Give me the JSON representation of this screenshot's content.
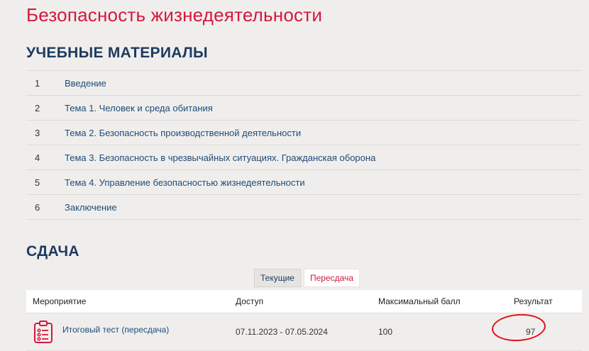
{
  "page": {
    "title": "Безопасность жизнедеятельности"
  },
  "materials": {
    "title": "УЧЕБНЫЕ МАТЕРИАЛЫ",
    "items": [
      {
        "num": "1",
        "label": "Введение"
      },
      {
        "num": "2",
        "label": "Тема 1. Человек и среда обитания"
      },
      {
        "num": "3",
        "label": "Тема 2. Безопасность производственной деятельности"
      },
      {
        "num": "4",
        "label": "Тема 3. Безопасность в чрезвычайных ситуациях. Гражданская оборона"
      },
      {
        "num": "5",
        "label": "Тема 4. Управление безопасностью жизнедеятельности"
      },
      {
        "num": "6",
        "label": "Заключение"
      }
    ]
  },
  "submission": {
    "title": "СДАЧА",
    "tabs": {
      "current": "Текущие",
      "retake": "Пересдача"
    },
    "columns": {
      "event": "Мероприятие",
      "access": "Доступ",
      "max_score": "Максимальный балл",
      "result": "Результат"
    },
    "rows": [
      {
        "icon": "clipboard-list-icon",
        "event": "Итоговый тест (пересдача)",
        "access": "07.11.2023 - 07.05.2024",
        "max_score": "100",
        "result": "97"
      }
    ]
  },
  "colors": {
    "accent_red": "#d4183d",
    "heading_blue": "#1e3a5f",
    "link_blue": "#1e4b7a",
    "annotation_circle": "#e0101f"
  }
}
